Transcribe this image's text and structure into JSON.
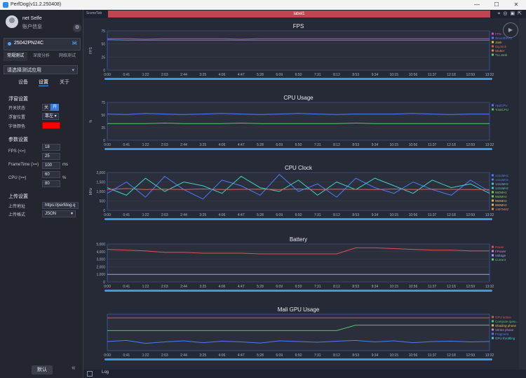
{
  "window": {
    "title": "PerfDog(v11.2.250408)",
    "controls": [
      "—",
      "☐",
      "✕"
    ]
  },
  "user": {
    "name": "net Selfe",
    "info": "账户信息"
  },
  "device": {
    "name": "25042PN24C"
  },
  "mode_tabs": [
    "常规测试",
    "深度分析",
    "网络测试"
  ],
  "app_select": {
    "placeholder": "请选择测试应用"
  },
  "sub_tabs": [
    "设备",
    "设置",
    "关于"
  ],
  "float": {
    "title": "浮窗设置",
    "switch_label": "开关状态",
    "off": "关",
    "on": "开",
    "position_label": "浮窗位置",
    "position_value": "靠左",
    "color_label": "字体颜色",
    "color": "#ff0000"
  },
  "params": {
    "title": "参数设置",
    "fps_label": "FPS (<=)",
    "fps_v1": "18",
    "fps_v2": "25",
    "ft_label": "FrameTime (>=)",
    "ft_value": "100",
    "ft_unit": "ms",
    "cpu_label": "CPU (>=)",
    "cpu_v1": "60",
    "cpu_v2": "80",
    "cpu_unit": "%"
  },
  "upload": {
    "title": "上传设置",
    "addr_label": "上传地址",
    "addr_value": "https://perfdog.q",
    "fmt_label": "上传格式",
    "fmt_value": "JSON"
  },
  "footer": {
    "default_button": "默认",
    "log": "Log"
  },
  "tabs": {
    "scene": "SceneTab",
    "label": "label1"
  },
  "x_ticks": [
    "0:00",
    "0:41",
    "1:22",
    "2:03",
    "2:44",
    "3:25",
    "4:06",
    "4:47",
    "5:28",
    "6:09",
    "6:50",
    "7:31",
    "8:12",
    "8:53",
    "9:34",
    "10:15",
    "10:56",
    "11:37",
    "12:18",
    "12:59",
    "13:32"
  ],
  "chart_data": [
    {
      "type": "line",
      "title": "FPS",
      "ylabel": "FPS",
      "yticks": [
        "75",
        "50",
        "25",
        "0"
      ],
      "ylim": [
        0,
        75
      ],
      "series": [
        {
          "name": "FPS",
          "color": "#d24ad2",
          "values": [
            60,
            60,
            59,
            60,
            60,
            60,
            60,
            59,
            60,
            60,
            60,
            60,
            60,
            60,
            60,
            60,
            60,
            60,
            60,
            60,
            60
          ]
        },
        {
          "name": "SmoothFPS",
          "color": "#4a7cff",
          "values": [
            58,
            57,
            57,
            57,
            57,
            57,
            57,
            57,
            57,
            57,
            57,
            57,
            57,
            57,
            57,
            57,
            57,
            57,
            57,
            57,
            57
          ]
        }
      ],
      "legend": [
        "FPS",
        "SmoothFPS",
        "Jank",
        "BigJank",
        "Stutter",
        "TLLJank"
      ],
      "legend_colors": [
        "#d24ad2",
        "#4a7cff",
        "#e0c040",
        "#e05050",
        "#ff8040",
        "#60d060"
      ]
    },
    {
      "type": "line",
      "title": "CPU Usage",
      "ylabel": "%",
      "yticks": [
        "75",
        "50",
        "25",
        "0"
      ],
      "ylim": [
        0,
        75
      ],
      "series": [
        {
          "name": "AppCPU",
          "color": "#4a7cff",
          "values": [
            52,
            51,
            53,
            52,
            51,
            52,
            53,
            52,
            51,
            52,
            53,
            52,
            51,
            52,
            52,
            52,
            53,
            52,
            51,
            52,
            52
          ]
        },
        {
          "name": "TotalCPU",
          "color": "#4fc86a",
          "values": [
            33,
            33,
            33,
            34,
            33,
            33,
            33,
            34,
            33,
            33,
            33,
            33,
            33,
            34,
            33,
            33,
            33,
            33,
            33,
            33,
            33
          ]
        }
      ],
      "legend": [
        "AppCPU",
        "TotalCPU"
      ],
      "legend_colors": [
        "#4a7cff",
        "#4fc86a"
      ]
    },
    {
      "type": "line",
      "title": "CPU Clock",
      "ylabel": "MHz",
      "yticks": [
        "2,000",
        "1,500",
        "1,000",
        "500",
        "0"
      ],
      "ylim": [
        0,
        2000
      ],
      "series": [
        {
          "name": "CPU0",
          "color": "#4a7cff",
          "values": [
            900,
            1500,
            700,
            1800,
            1100,
            600,
            1600,
            1300,
            800,
            1900,
            1000,
            1400,
            700,
            1700,
            1200,
            900,
            1500,
            1100,
            800,
            1600,
            1000
          ]
        },
        {
          "name": "CPU1",
          "color": "#3fd0c0",
          "values": [
            1200,
            800,
            1700,
            1000,
            1500,
            1300,
            900,
            1800,
            1200,
            1000,
            1600,
            800,
            1500,
            1100,
            1700,
            1300,
            900,
            1600,
            1200,
            1400,
            900
          ]
        },
        {
          "name": "CPU2",
          "color": "#e06060",
          "values": [
            1100,
            1150,
            1100,
            1120,
            1100,
            1130,
            1100,
            1110,
            1120,
            1100,
            1130,
            1100,
            1120,
            1110,
            1100,
            1130,
            1100,
            1120,
            1110,
            1100,
            1100
          ]
        }
      ],
      "legend": [
        "1411MHz",
        "1411MHz",
        "1411MHz",
        "1411MHz",
        "960MHz",
        "960MHz",
        "960MHz",
        "960MHz",
        "1497MHz"
      ],
      "legend_colors": [
        "#4a7cff",
        "#4a7cff",
        "#3fd0c0",
        "#3fd0c0",
        "#7fd040",
        "#7fd040",
        "#e0c040",
        "#e0c040",
        "#ff8040"
      ]
    },
    {
      "type": "line",
      "title": "Battery",
      "ylabel": "",
      "yticks": [
        "5,000",
        "4,000",
        "3,000",
        "2,000",
        "1,000",
        "0"
      ],
      "ylim": [
        0,
        5000
      ],
      "series": [
        {
          "name": "Power",
          "color": "#e05050",
          "values": [
            4300,
            4200,
            4100,
            3900,
            3900,
            3800,
            3800,
            3800,
            3700,
            3700,
            3700,
            3700,
            3700,
            4500,
            4500,
            4400,
            4300,
            4200,
            4200,
            4100,
            4100
          ]
        },
        {
          "name": "Voltage",
          "color": "#9aa0ff",
          "values": [
            1000,
            1000,
            1000,
            1000,
            1000,
            1000,
            1000,
            1000,
            1000,
            1000,
            1000,
            1000,
            1000,
            1000,
            1000,
            1000,
            1000,
            1000,
            1000,
            1000,
            1000
          ]
        }
      ],
      "legend": [
        "Power",
        "FPower",
        "Voltage",
        "Current"
      ],
      "legend_colors": [
        "#e05050",
        "#d080d0",
        "#9aa0ff",
        "#60d060"
      ]
    },
    {
      "type": "line",
      "title": "Mali GPU Usage",
      "ylabel": "",
      "yticks": [],
      "ylim": [
        0,
        100
      ],
      "series": [
        {
          "name": "GPU active",
          "color": "#e05050",
          "values": [
            90,
            90,
            90,
            90,
            90,
            90,
            90,
            90,
            90,
            90,
            90,
            90,
            90,
            90,
            90,
            90,
            90,
            90,
            90,
            90,
            90
          ]
        },
        {
          "name": "Compute",
          "color": "#4fc86a",
          "values": [
            55,
            55,
            55,
            55,
            55,
            55,
            55,
            55,
            55,
            55,
            55,
            55,
            55,
            70,
            70,
            70,
            70,
            70,
            70,
            70,
            70
          ]
        },
        {
          "name": "Fragment",
          "color": "#4a7cff",
          "values": [
            25,
            28,
            20,
            24,
            27,
            22,
            26,
            24,
            21,
            27,
            25,
            23,
            26,
            28,
            24,
            27,
            22,
            25,
            26,
            24,
            25
          ]
        }
      ],
      "legend": [
        "GPU active",
        "Compute queu..",
        "Shading phase",
        "Vertex phase",
        "Fragment",
        "GPU throttling"
      ],
      "legend_colors": [
        "#e05050",
        "#4fc86a",
        "#e0c040",
        "#d080d0",
        "#4a7cff",
        "#3fd0c0"
      ]
    }
  ]
}
